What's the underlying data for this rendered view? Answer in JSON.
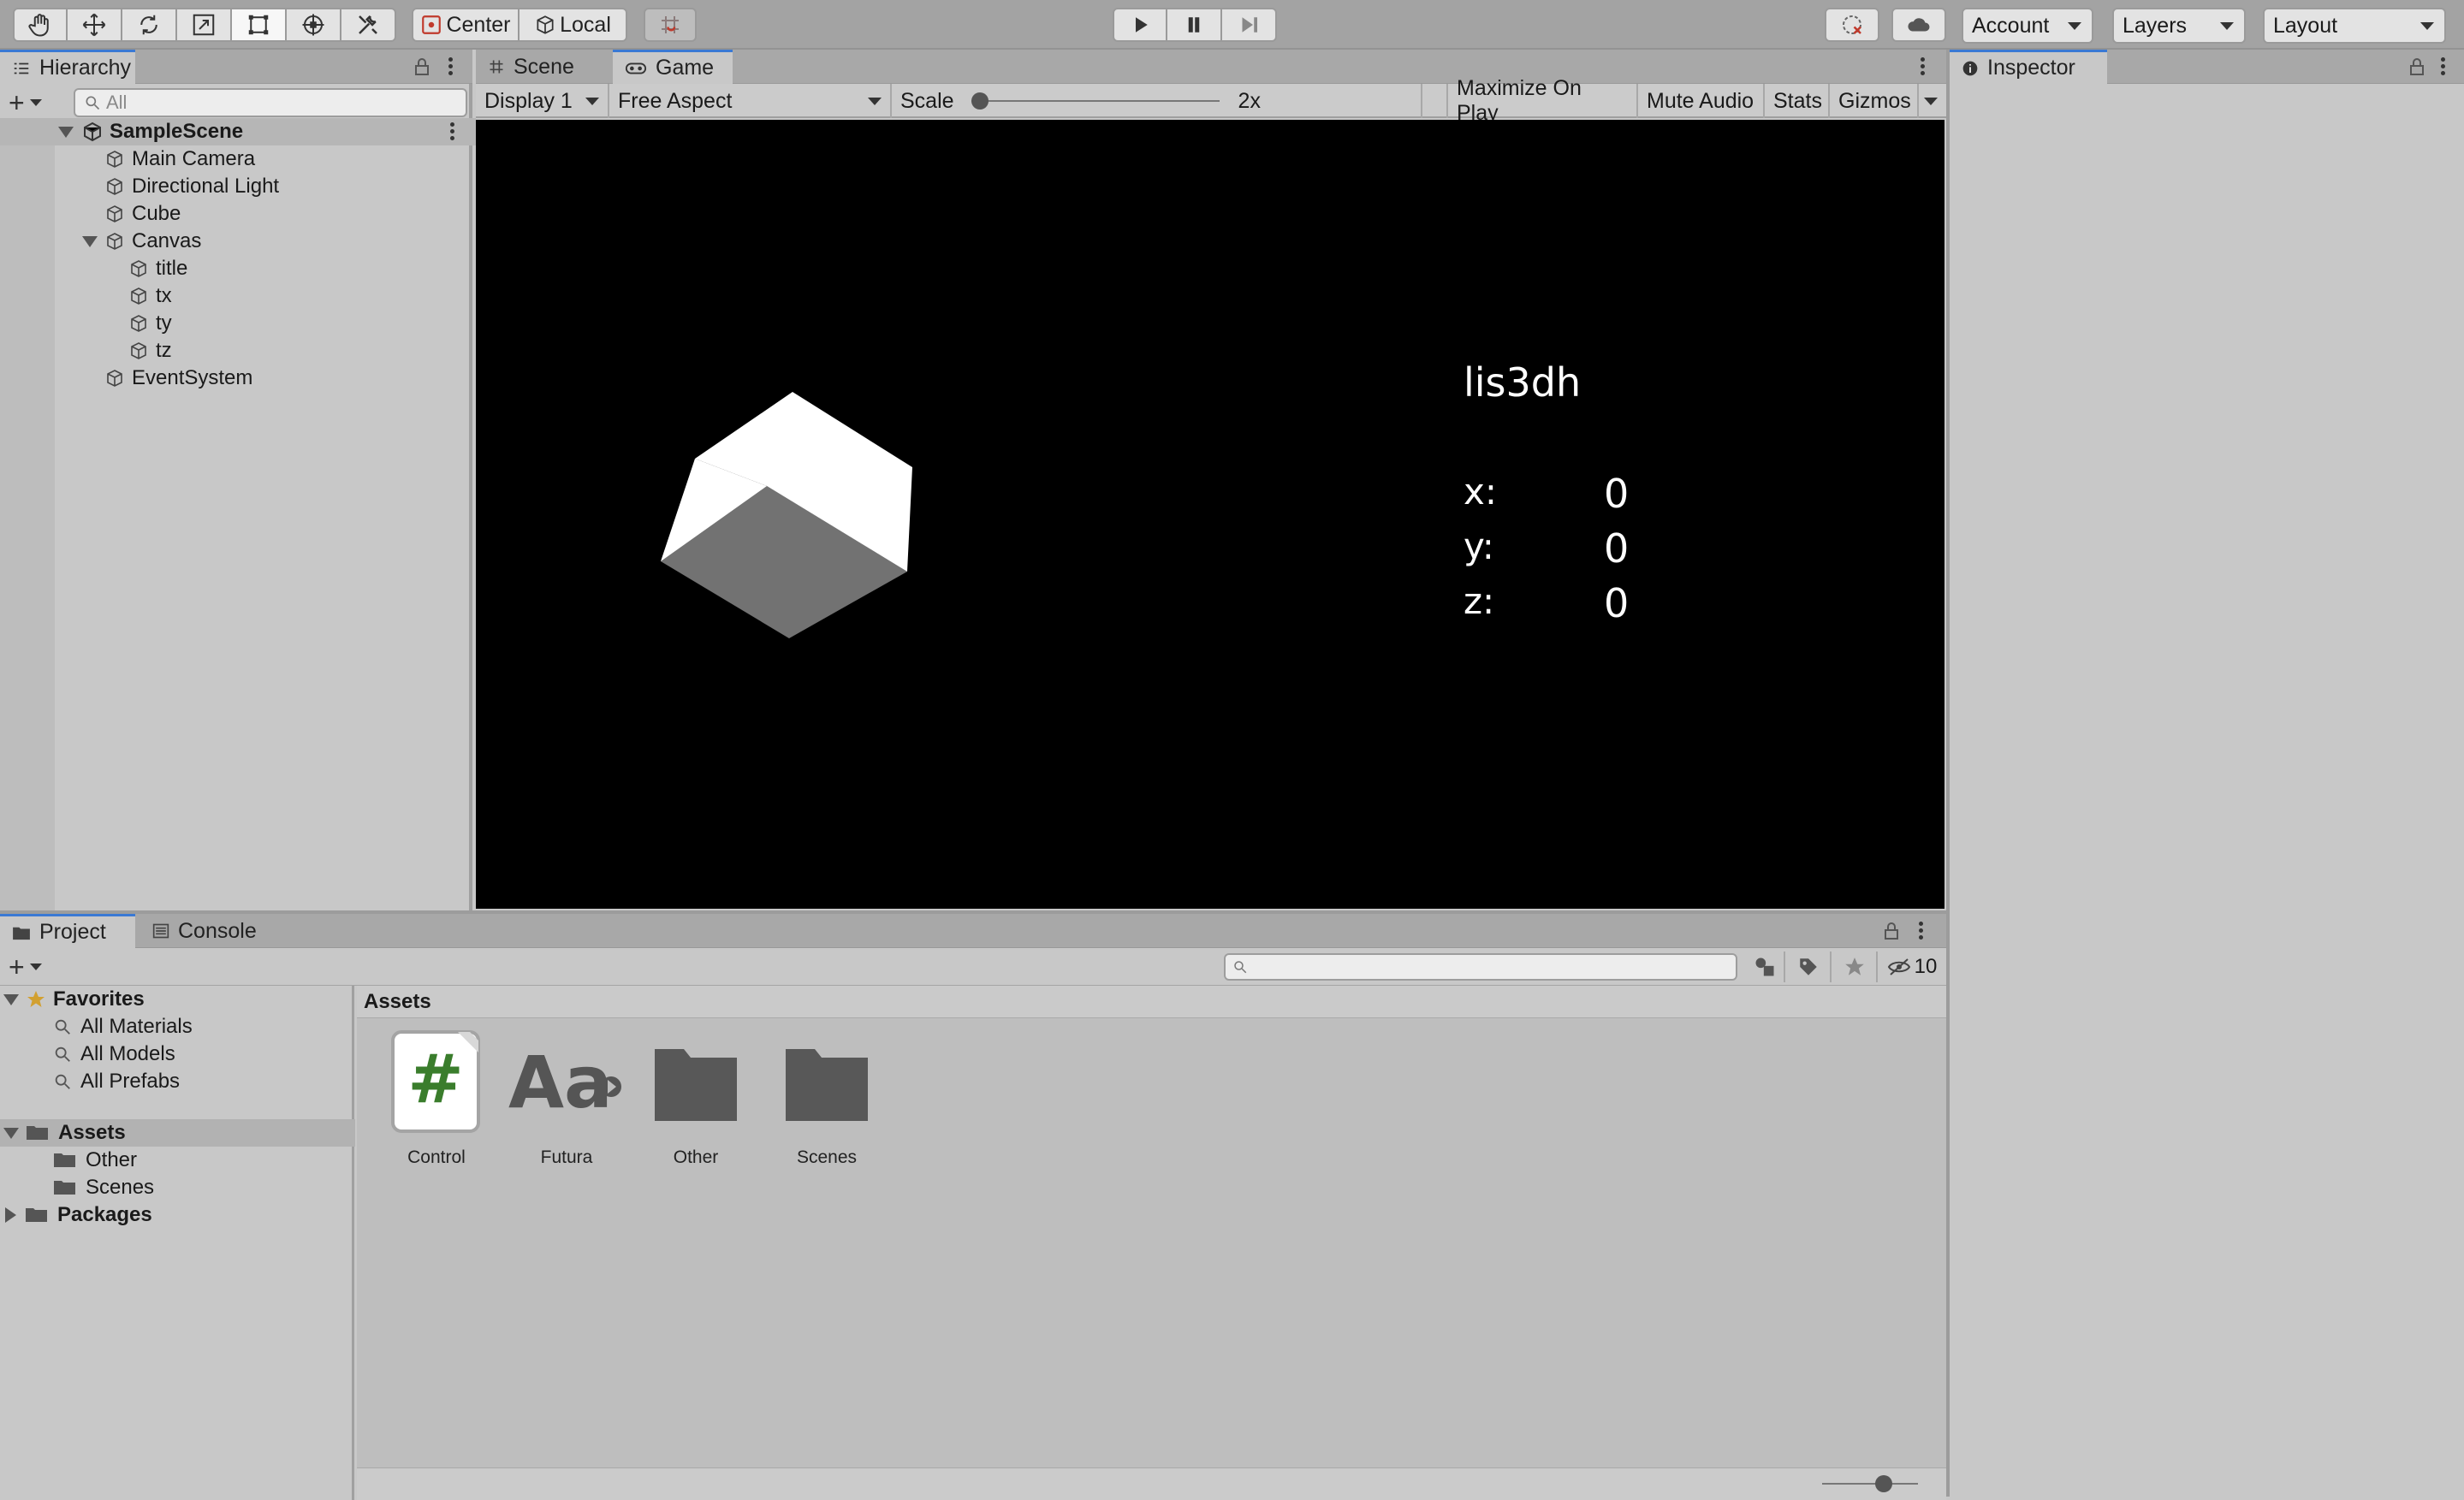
{
  "toolbar": {
    "tools": [
      "hand-tool",
      "move-tool",
      "rotate-tool",
      "scale-tool",
      "rect-tool",
      "transform-tool",
      "custom-tool"
    ],
    "pivot_mode": "Center",
    "pivot_rotation": "Local",
    "account": "Account",
    "layers": "Layers",
    "layout": "Layout"
  },
  "hierarchy": {
    "tab": "Hierarchy",
    "search_placeholder": "All",
    "scene": "SampleScene",
    "items": [
      {
        "label": "Main Camera"
      },
      {
        "label": "Directional Light"
      },
      {
        "label": "Cube"
      },
      {
        "label": "Canvas"
      },
      {
        "label": "title"
      },
      {
        "label": "tx"
      },
      {
        "label": "ty"
      },
      {
        "label": "tz"
      },
      {
        "label": "EventSystem"
      }
    ]
  },
  "view_tabs": {
    "scene": "Scene",
    "game": "Game"
  },
  "game_toolbar": {
    "display": "Display 1",
    "aspect": "Free Aspect",
    "scale_label": "Scale",
    "scale_value": "2x",
    "maximize": "Maximize On Play",
    "mute": "Mute Audio",
    "stats": "Stats",
    "gizmos": "Gizmos"
  },
  "game_hud": {
    "title": "lis3dh",
    "x_label": "x:",
    "x_value": "0",
    "y_label": "y:",
    "y_value": "0",
    "z_label": "z:",
    "z_value": "0"
  },
  "inspector": {
    "tab": "Inspector"
  },
  "project": {
    "tab": "Project",
    "console_tab": "Console",
    "hidden_count": "10",
    "favorites": {
      "label": "Favorites",
      "items": [
        "All Materials",
        "All Models",
        "All Prefabs"
      ]
    },
    "assets_root": "Assets",
    "asset_folders": [
      "Other",
      "Scenes"
    ],
    "packages": "Packages",
    "breadcrumb": "Assets",
    "assets": [
      {
        "label": "Control",
        "icon": "csharp-script-icon"
      },
      {
        "label": "Futura",
        "icon": "font-icon"
      },
      {
        "label": "Other",
        "icon": "folder-icon"
      },
      {
        "label": "Scenes",
        "icon": "folder-icon"
      }
    ]
  },
  "colors": {
    "accent": "#3a79d4",
    "toolbar_bg": "#a3a3a3",
    "panel_bg": "#c8c8c8",
    "game_bg": "#000000",
    "script_hash": "#3a7d2c"
  }
}
